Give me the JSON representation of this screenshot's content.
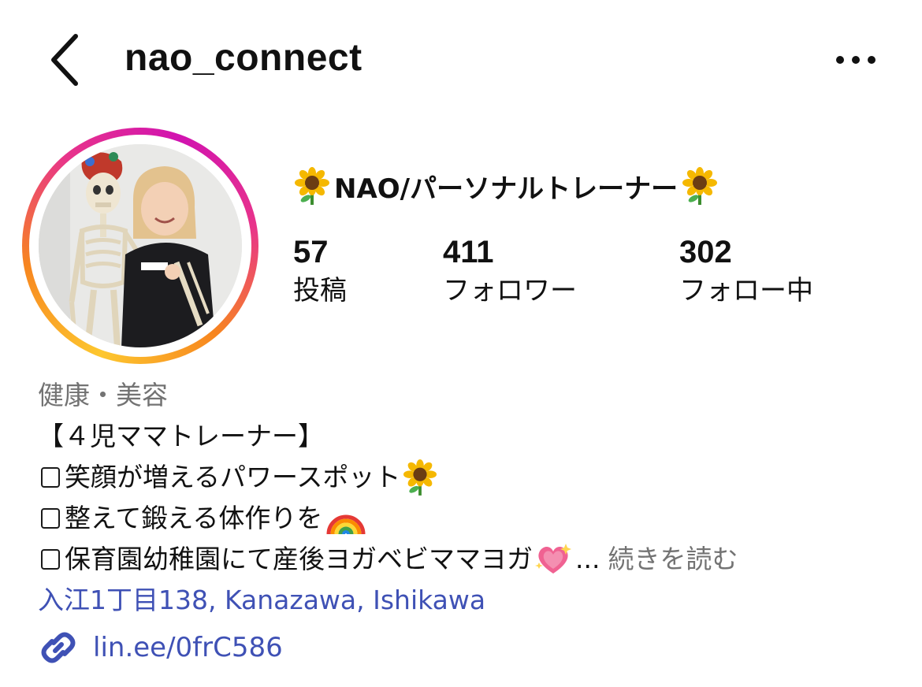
{
  "header": {
    "username": "nao_connect",
    "back_icon": "chevron-left-icon",
    "more_icon": "ellipsis-icon"
  },
  "profile": {
    "display_name": "NAO/パーソナルトレーナー",
    "name_emoji": "sunflower-icon",
    "story_ring_colors": [
      "#fdc72f",
      "#f7861f",
      "#e8348a",
      "#d113b0"
    ],
    "stats": [
      {
        "value": "57",
        "label": "投稿"
      },
      {
        "value": "411",
        "label": "フォロワー"
      },
      {
        "value": "302",
        "label": "フォロー中"
      }
    ]
  },
  "bio": {
    "category": "健康・美容",
    "lines": [
      "【４児ママトレーナー】",
      "笑顔が増えるパワースポット",
      "整えて鍛える体作りを",
      "保育園幼稚園にて産後ヨガベビママヨガ"
    ],
    "ellipsis": "...",
    "more_label": "続きを読む",
    "location": "入江1丁目138, Kanazawa, Ishikawa",
    "link": "lin.ee/0frC586",
    "link_icon": "link-icon",
    "link_color": "#3f51b5"
  }
}
